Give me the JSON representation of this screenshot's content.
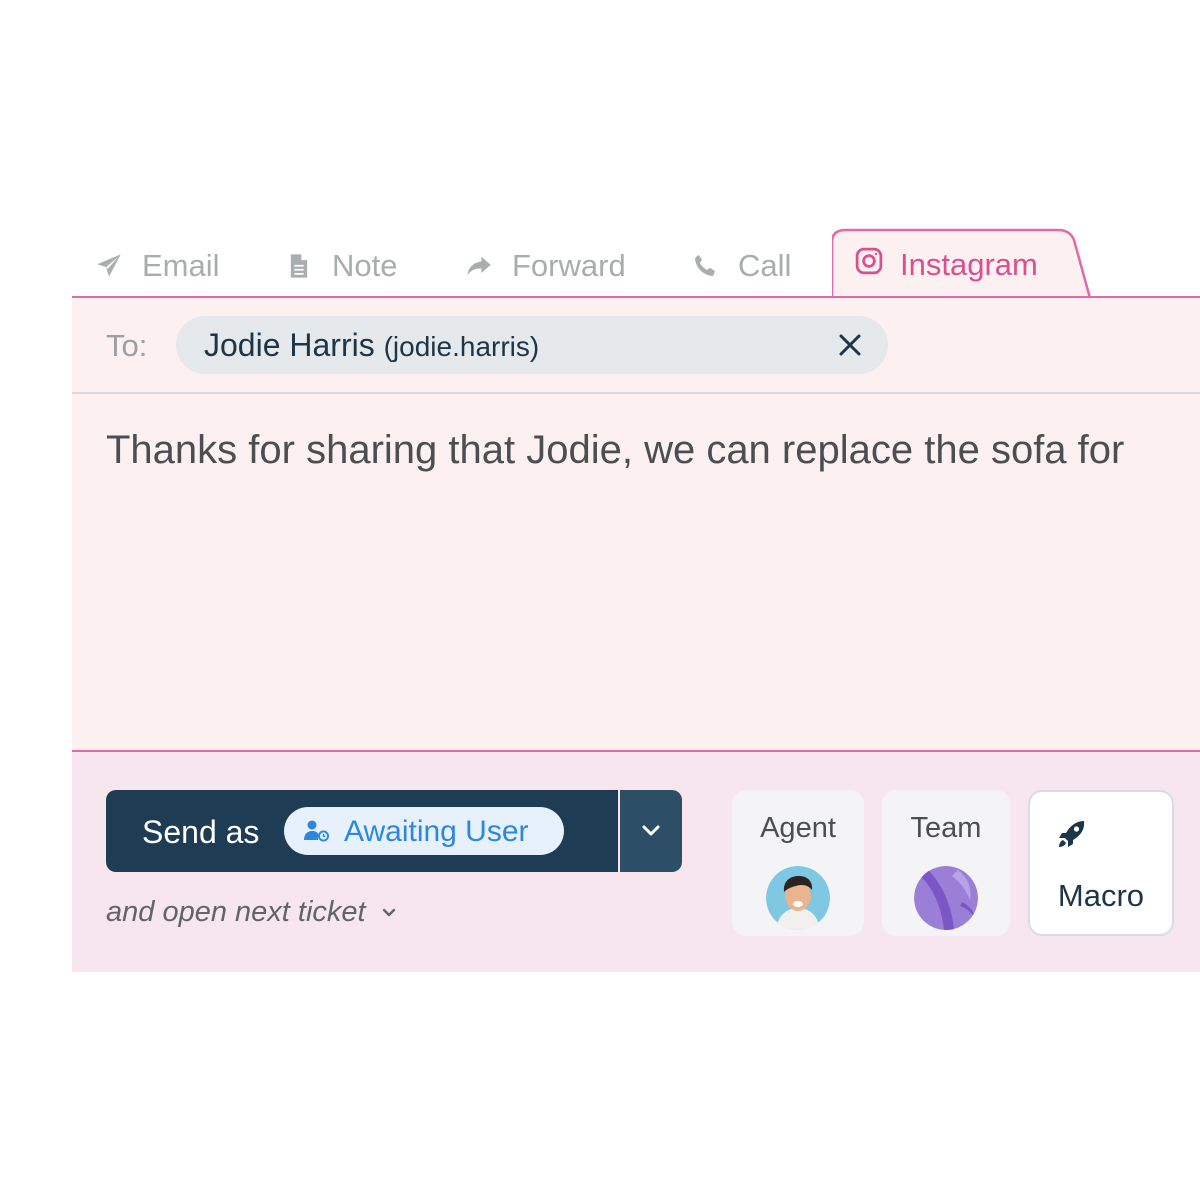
{
  "tabs": [
    {
      "label": "Email",
      "icon": "paper-plane-icon"
    },
    {
      "label": "Note",
      "icon": "document-icon"
    },
    {
      "label": "Forward",
      "icon": "forward-arrow-icon"
    },
    {
      "label": "Call",
      "icon": "phone-icon"
    },
    {
      "label": "Instagram",
      "icon": "instagram-icon",
      "active": true
    }
  ],
  "to": {
    "label": "To:",
    "recipient_name": "Jodie Harris",
    "recipient_handle": "(jodie.harris)"
  },
  "message": {
    "text": "Thanks for sharing that Jodie, we can replace the sofa for"
  },
  "send": {
    "label": "Send as",
    "status": "Awaiting User",
    "open_next": "and open next ticket"
  },
  "assign": {
    "agent_label": "Agent",
    "team_label": "Team",
    "macro_label": "Macro"
  },
  "colors": {
    "accent": "#e36aa6",
    "instagram": "#d9508f",
    "composer_bg": "#fdf0f0",
    "footer_bg": "#f8e6ee",
    "send_button": "#1e3c53",
    "status_text": "#2d87e0"
  }
}
